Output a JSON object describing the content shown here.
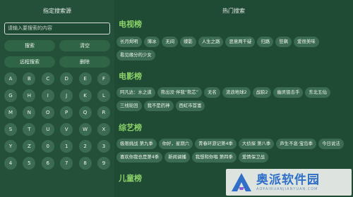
{
  "left": {
    "title": "指定搜索源",
    "search_placeholder": "请输入要搜索的内容",
    "buttons": [
      [
        "搜索",
        "清空"
      ],
      [
        "远程搜索",
        "删除"
      ]
    ],
    "keys": [
      "A",
      "B",
      "C",
      "D",
      "E",
      "F",
      "G",
      "H",
      "I",
      "J",
      "K",
      "L",
      "M",
      "N",
      "O",
      "P",
      "Q",
      "R",
      "S",
      "T",
      "U",
      "V",
      "W",
      "X",
      "Y",
      "Z",
      "0",
      "1",
      "2",
      "3",
      "4",
      "5",
      "6",
      "7",
      "8",
      "9"
    ]
  },
  "right": {
    "title": "热门搜索",
    "sections": [
      {
        "title": "电视榜",
        "items": [
          "长月烬明",
          "薄冰",
          "无间",
          "蝶影",
          "人生之路",
          "恶意两千疑",
          "归路",
          "狂飙",
          "爱很美味",
          "看见缘分的少女"
        ]
      },
      {
        "title": "电影榜",
        "items": [
          "阿凡达：水之道",
          "熊出没·伴我“熊芯”",
          "无名",
          "流浪地球2",
          "战狼2",
          "幽灵狙击手",
          "东北五仙",
          "三线轮回",
          "我不是药神",
          "西虹市首富"
        ]
      },
      {
        "title": "综艺榜",
        "items": [
          "极限挑战 第九季",
          "你好，星期六",
          "青春环游记第4季",
          "大侦探 第八季",
          "声生不息·宝岛季",
          "今日说法",
          "喜欢你我也是第4季",
          "新闻调播",
          "我想和你唱 第四季",
          "爱情保卫战"
        ]
      },
      {
        "title": "儿童榜",
        "items": []
      }
    ]
  },
  "watermark": {
    "main": "奥派软件园",
    "sub": "AOPAIRUANJIANYUAN.COM"
  }
}
